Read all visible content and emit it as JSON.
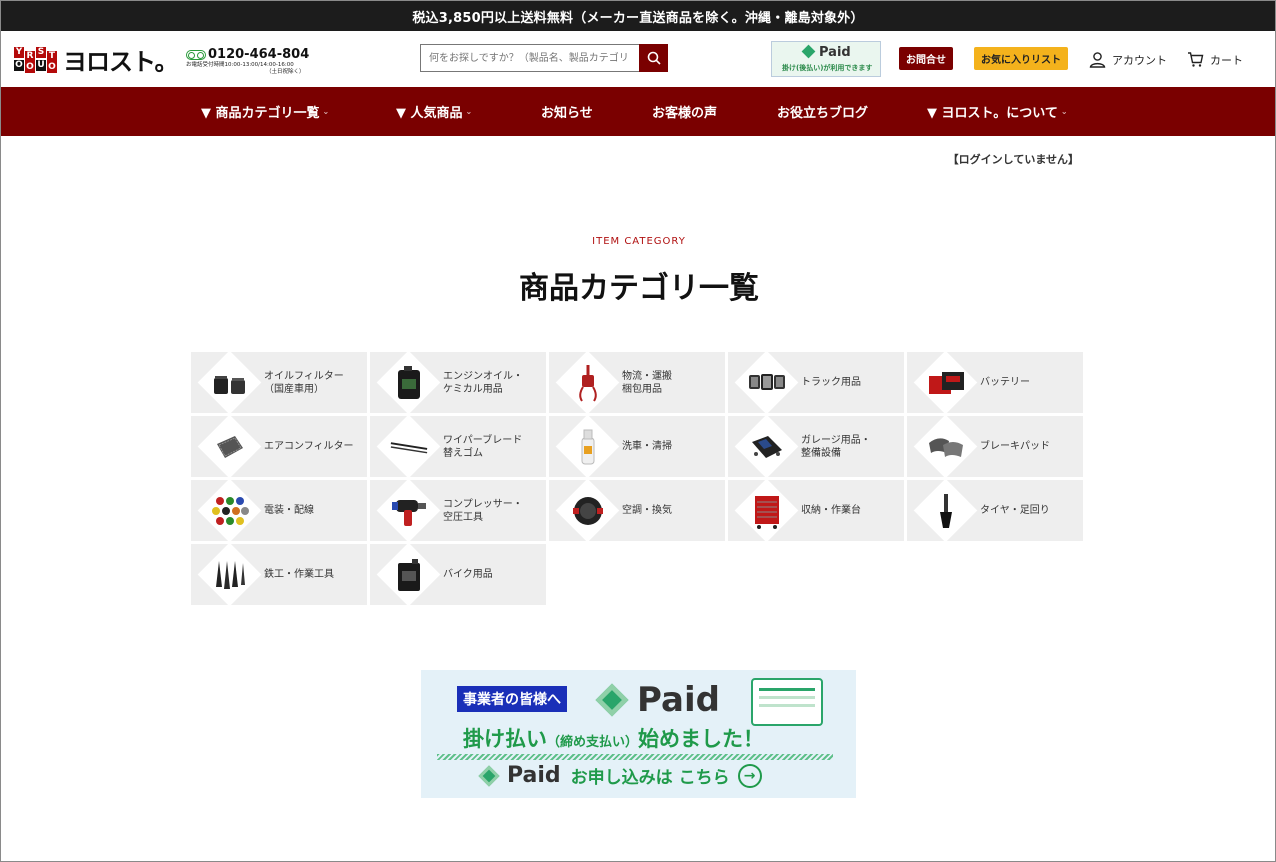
{
  "topbar": {
    "text": "税込3,850円以上送料無料（メーカー直送商品を除く。沖縄・離島対象外）"
  },
  "header": {
    "logo_letters": [
      "Y",
      "R",
      "S",
      "T",
      "O",
      "O",
      "U",
      "O"
    ],
    "logo_text": "ヨロスト。",
    "phone": "0120-464-804",
    "phone_hours": "お電話受付時間10:00-13:00/14:00-16:00",
    "phone_hours_note": "（土日祝除く）",
    "search_placeholder": "何をお探しですか？（製品名、製品カテゴリ",
    "paid_logo": "Paid",
    "paid_sub": "掛け(後払い)が利用できます",
    "contact_label": "お問合せ",
    "favorites_label": "お気に入りリスト",
    "account_label": "アカウント",
    "cart_label": "カート"
  },
  "nav": {
    "items": [
      {
        "label": "▼ 商品カテゴリ一覧",
        "caret": "⌄"
      },
      {
        "label": "▼ 人気商品",
        "caret": "⌄"
      },
      {
        "label": "お知らせ",
        "caret": ""
      },
      {
        "label": "お客様の声",
        "caret": ""
      },
      {
        "label": "お役立ちブログ",
        "caret": ""
      },
      {
        "label": "▼ ヨロスト。について",
        "caret": "⌄"
      }
    ]
  },
  "login_status": "【ログインしていません】",
  "section": {
    "subtitle": "ITEM CATEGORY",
    "title": "商品カテゴリ一覧"
  },
  "categories": [
    {
      "label": "オイルフィルター\n（国産車用）",
      "icon": "oil-filter-icon"
    },
    {
      "label": "エンジンオイル・\nケミカル用品",
      "icon": "engine-oil-icon"
    },
    {
      "label": "物流・運搬\n梱包用品",
      "icon": "chain-hoist-icon"
    },
    {
      "label": "トラック用品",
      "icon": "work-light-icon"
    },
    {
      "label": "バッテリー",
      "icon": "battery-icon"
    },
    {
      "label": "エアコンフィルター",
      "icon": "air-filter-icon"
    },
    {
      "label": "ワイパーブレード\n替えゴム",
      "icon": "wiper-blade-icon"
    },
    {
      "label": "洗車・清掃",
      "icon": "spray-bottle-icon"
    },
    {
      "label": "ガレージ用品・\n整備設備",
      "icon": "creeper-icon"
    },
    {
      "label": "ブレーキパッド",
      "icon": "brake-pad-icon"
    },
    {
      "label": "電装・配線",
      "icon": "wire-spools-icon"
    },
    {
      "label": "コンプレッサー・\n空圧工具",
      "icon": "impact-wrench-icon"
    },
    {
      "label": "空調・換気",
      "icon": "blower-fan-icon"
    },
    {
      "label": "収納・作業台",
      "icon": "tool-cabinet-icon"
    },
    {
      "label": "タイヤ・足回り",
      "icon": "tire-valve-icon"
    },
    {
      "label": "鉄工・作業工具",
      "icon": "step-drill-icon"
    },
    {
      "label": "バイク用品",
      "icon": "oil-can-icon"
    }
  ],
  "paid_banner": {
    "tag": "事業者の皆様へ",
    "logo": "Paid",
    "main_before": "掛け払い",
    "main_small": "（締め支払い）",
    "main_after": "始めました！",
    "apply_logo": "Paid",
    "apply_text": "お申し込みは こちら",
    "arrow": "→"
  },
  "colors": {
    "brand_red": "#7a0000",
    "accent_yellow": "#f4b21c",
    "paid_green": "#1f9a4a",
    "topbar_bg": "#1c1c1c"
  }
}
